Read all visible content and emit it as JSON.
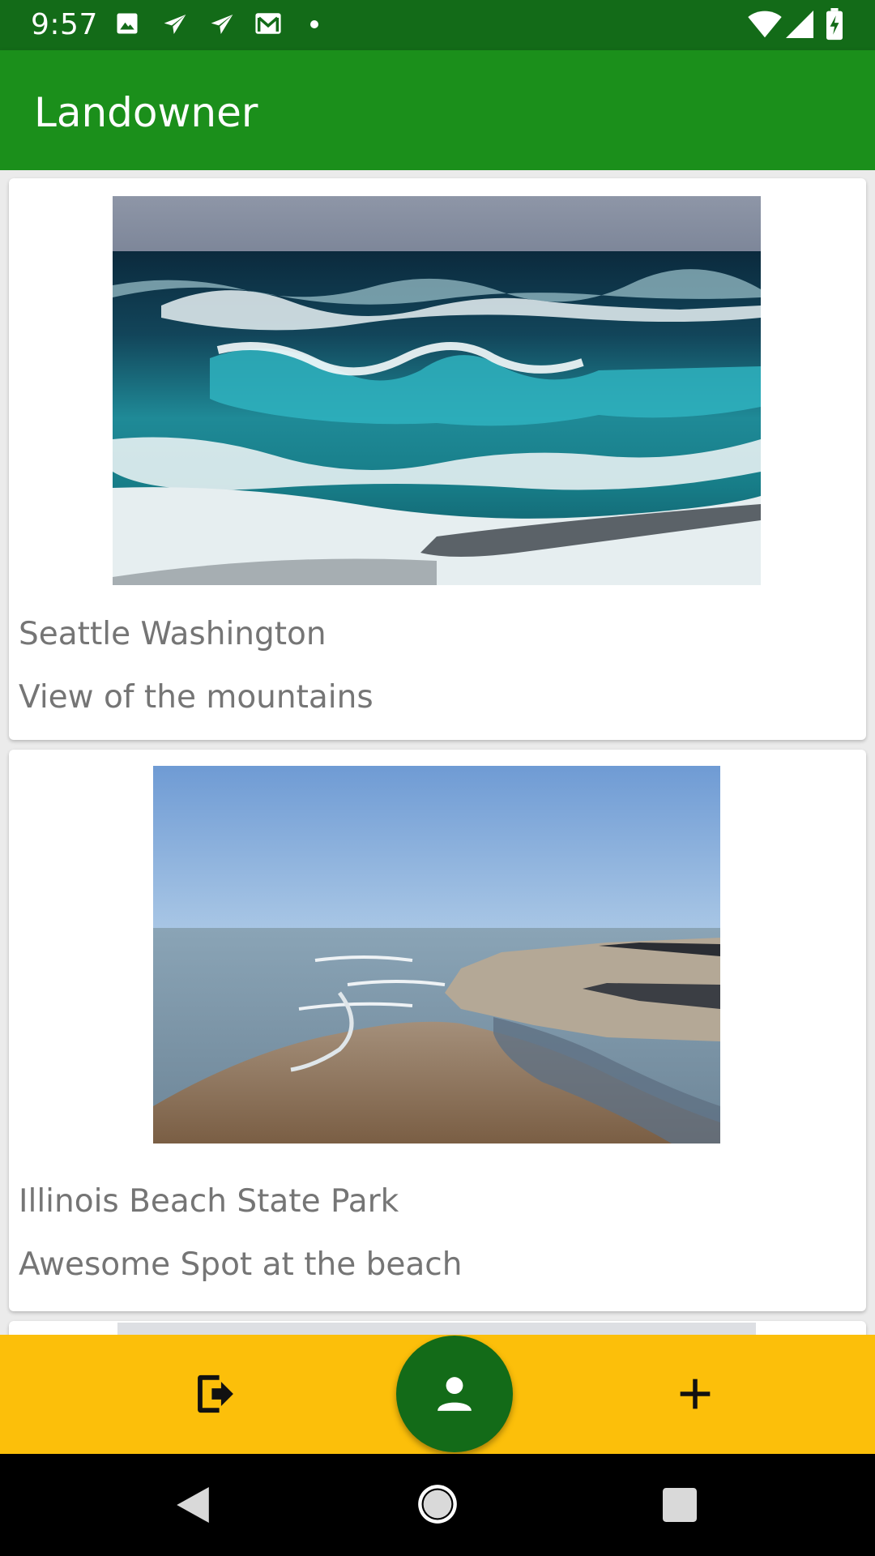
{
  "status_bar": {
    "time": "9:57",
    "left_icons": [
      "image-icon",
      "send-icon",
      "send-icon",
      "gmail-icon",
      "dot-icon"
    ],
    "right_icons": [
      "wifi-icon",
      "signal-icon",
      "battery-charging-icon"
    ]
  },
  "app_bar": {
    "title": "Landowner",
    "color": "#1b8f1b"
  },
  "listings": [
    {
      "title": "Seattle Washington",
      "description": "View of the mountains",
      "image": "ocean-waves-photo"
    },
    {
      "title": "Illinois Beach State Park",
      "description": "Awesome Spot at the beach",
      "image": "beach-shoreline-photo"
    }
  ],
  "bottom_bar": {
    "color": "#fcbf0a",
    "fab_color": "#136b18",
    "left_icon": "logout-icon",
    "center_icon": "person-icon",
    "right_icon": "add-icon"
  },
  "nav_bar": {
    "buttons": [
      "back-icon",
      "home-icon",
      "recents-icon"
    ]
  }
}
